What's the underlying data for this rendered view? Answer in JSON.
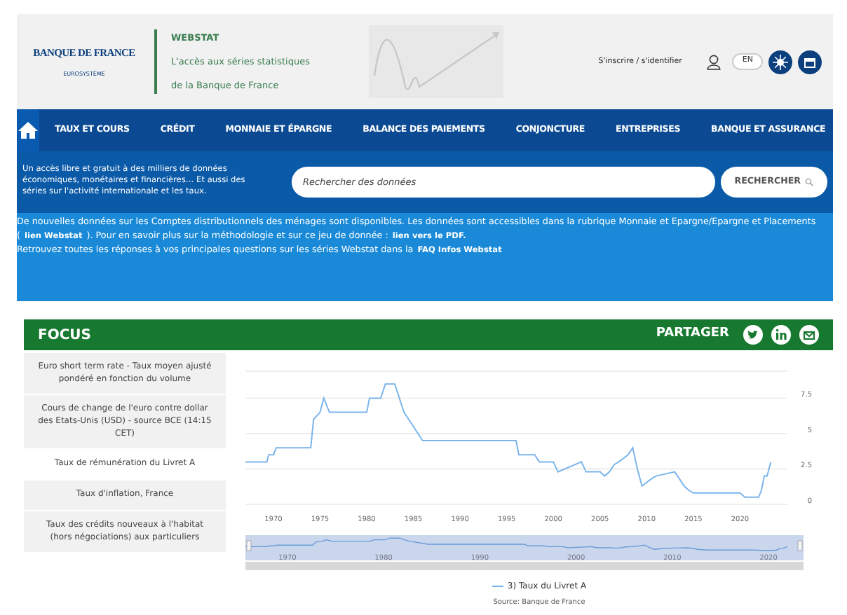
{
  "header": {
    "logo": {
      "name": "BANQUE DE FRANCE",
      "subtitle": "EUROSYSTÈME"
    },
    "site": "WEBSTAT",
    "tagline": [
      "L'accès aux séries statistiques",
      "de la Banque de France"
    ],
    "login": "S'inscrire / s'identifier",
    "language": "EN"
  },
  "nav": {
    "items": [
      "TAUX ET COURS",
      "CRÉDIT",
      "MONNAIE ET ÉPARGNE",
      "BALANCE DES PAIEMENTS",
      "CONJONCTURE",
      "ENTREPRISES",
      "BANQUE ET ASSURANCE"
    ]
  },
  "search": {
    "intro": "Un accès libre et gratuit à des milliers de données économiques, monétaires et financières… Et aussi des séries sur l'activité internationale et les taux.",
    "placeholder": "Rechercher des données",
    "button": "RECHERCHER"
  },
  "notice": [
    [
      {
        "text": "De nouvelles données sur les Comptes distributionnels des ménages sont disponibles. Les données sont accessibles dans la rubrique Monnaie et Epargne/Epargne et Placements (",
        "link": false
      },
      {
        "text": "lien Webstat",
        "link": true
      },
      {
        "text": "). Pour en savoir plus sur la méthodologie et  sur ce  jeu de donnée :",
        "link": false
      },
      {
        "text": "lien vers le PDF.",
        "link": true
      }
    ],
    [
      {
        "text": "Retrouvez toutes les réponses à vos principales questions sur les séries Webstat dans la",
        "link": false
      },
      {
        "text": "FAQ Infos Webstat",
        "link": true
      }
    ]
  ],
  "focus": {
    "title": "FOCUS",
    "share": "PARTAGER",
    "items": [
      {
        "label": "Euro short term rate - Taux moyen ajusté pondéré en fonction du volume",
        "selected": false
      },
      {
        "label": "Cours de change de l'euro contre dollar des Etats-Unis (USD) - source BCE (14:15 CET)",
        "selected": false
      },
      {
        "label": "Taux de rémunération du Livret A",
        "selected": true
      },
      {
        "label": "Taux d'inflation, France",
        "selected": false
      },
      {
        "label": "Taux des crédits nouveaux à l'habitat (hors négociations) aux particuliers",
        "selected": false
      }
    ],
    "chart_data": {
      "type": "line",
      "grid": true,
      "xlim": [
        1967,
        2025
      ],
      "ylim": [
        0,
        9.5
      ],
      "xticks": [
        1970,
        1975,
        1980,
        1985,
        1990,
        1995,
        2000,
        2005,
        2010,
        2015,
        2020
      ],
      "yticks": [
        0,
        2.5,
        5,
        7.5
      ],
      "x": [
        1967,
        1969.3,
        1969.5,
        1970,
        1970.3,
        1974,
        1974.3,
        1975,
        1975.4,
        1976,
        1980,
        1980.3,
        1981.5,
        1982,
        1983,
        1983.5,
        1984,
        1986,
        1996,
        1996.3,
        1998,
        1998.5,
        2000,
        2000.5,
        2003,
        2003.5,
        2005,
        2005.5,
        2006,
        2006.5,
        2007,
        2008,
        2008.5,
        2009,
        2009.5,
        2010.5,
        2011,
        2013,
        2013.5,
        2014,
        2014.5,
        2015,
        2020,
        2020.5,
        2022,
        2022.3,
        2022.6,
        2022.9,
        2023.3
      ],
      "series": [
        {
          "name": "3) Taux du Livret A",
          "color": "#7cb5ec",
          "values": [
            3,
            3,
            3.5,
            3.5,
            4,
            4,
            6,
            6.5,
            7.5,
            6.5,
            6.5,
            7.5,
            7.5,
            8.5,
            8.5,
            7.5,
            6.5,
            4.5,
            4.5,
            3.5,
            3.5,
            3,
            3,
            2.3,
            3,
            2.3,
            2.3,
            2,
            2.3,
            2.8,
            3,
            3.5,
            4,
            2.5,
            1.3,
            1.8,
            2,
            2.3,
            1.8,
            1.3,
            1,
            0.8,
            0.8,
            0.5,
            0.5,
            1,
            2,
            2,
            3
          ]
        }
      ]
    },
    "navigator_labels": [
      "1970",
      "1980",
      "1990",
      "2000",
      "2010",
      "2020"
    ],
    "source": "Source: Banque de France"
  }
}
